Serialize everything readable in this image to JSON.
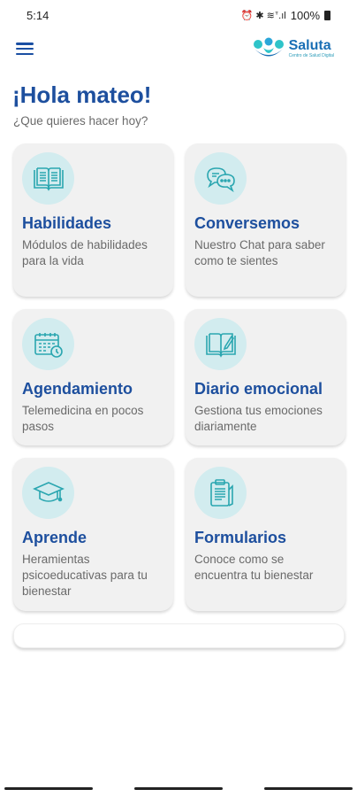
{
  "status_bar": {
    "time": "5:14",
    "indicators": "⏰ ✱ ≋ᐪ.ıl",
    "battery_percent": "100%"
  },
  "app_bar": {
    "menu_icon": "hamburger-menu-icon",
    "brand_name": "Saluta",
    "brand_tagline": "Centro de Salud Digital",
    "brand_color": "#1a6fb5"
  },
  "greeting": "¡Hola mateo!",
  "subtitle": "¿Que quieres hacer hoy?",
  "cards": [
    {
      "title": "Habilidades",
      "description": "Módulos de habilidades para la vida",
      "icon": "open-book-icon"
    },
    {
      "title": "Conversemos",
      "description": "Nuestro Chat para saber como te sientes",
      "icon": "chat-bubbles-icon"
    },
    {
      "title": "Agendamiento",
      "description": "Telemedicina en pocos pasos",
      "icon": "calendar-clock-icon"
    },
    {
      "title": "Diario emocional",
      "description": "Gestiona tus emociones diariamente",
      "icon": "journal-pen-icon"
    },
    {
      "title": "Aprende",
      "description": "Heramientas psicoeducativas para tu bienestar",
      "icon": "graduation-cap-icon"
    },
    {
      "title": "Formularios",
      "description": "Conoce como se encuentra tu bienestar",
      "icon": "clipboard-icon"
    }
  ],
  "colors": {
    "title_blue": "#1d4f9e",
    "icon_teal": "#2aa6b0",
    "icon_bg": "#d2ecef",
    "card_bg": "#f1f1f1"
  }
}
